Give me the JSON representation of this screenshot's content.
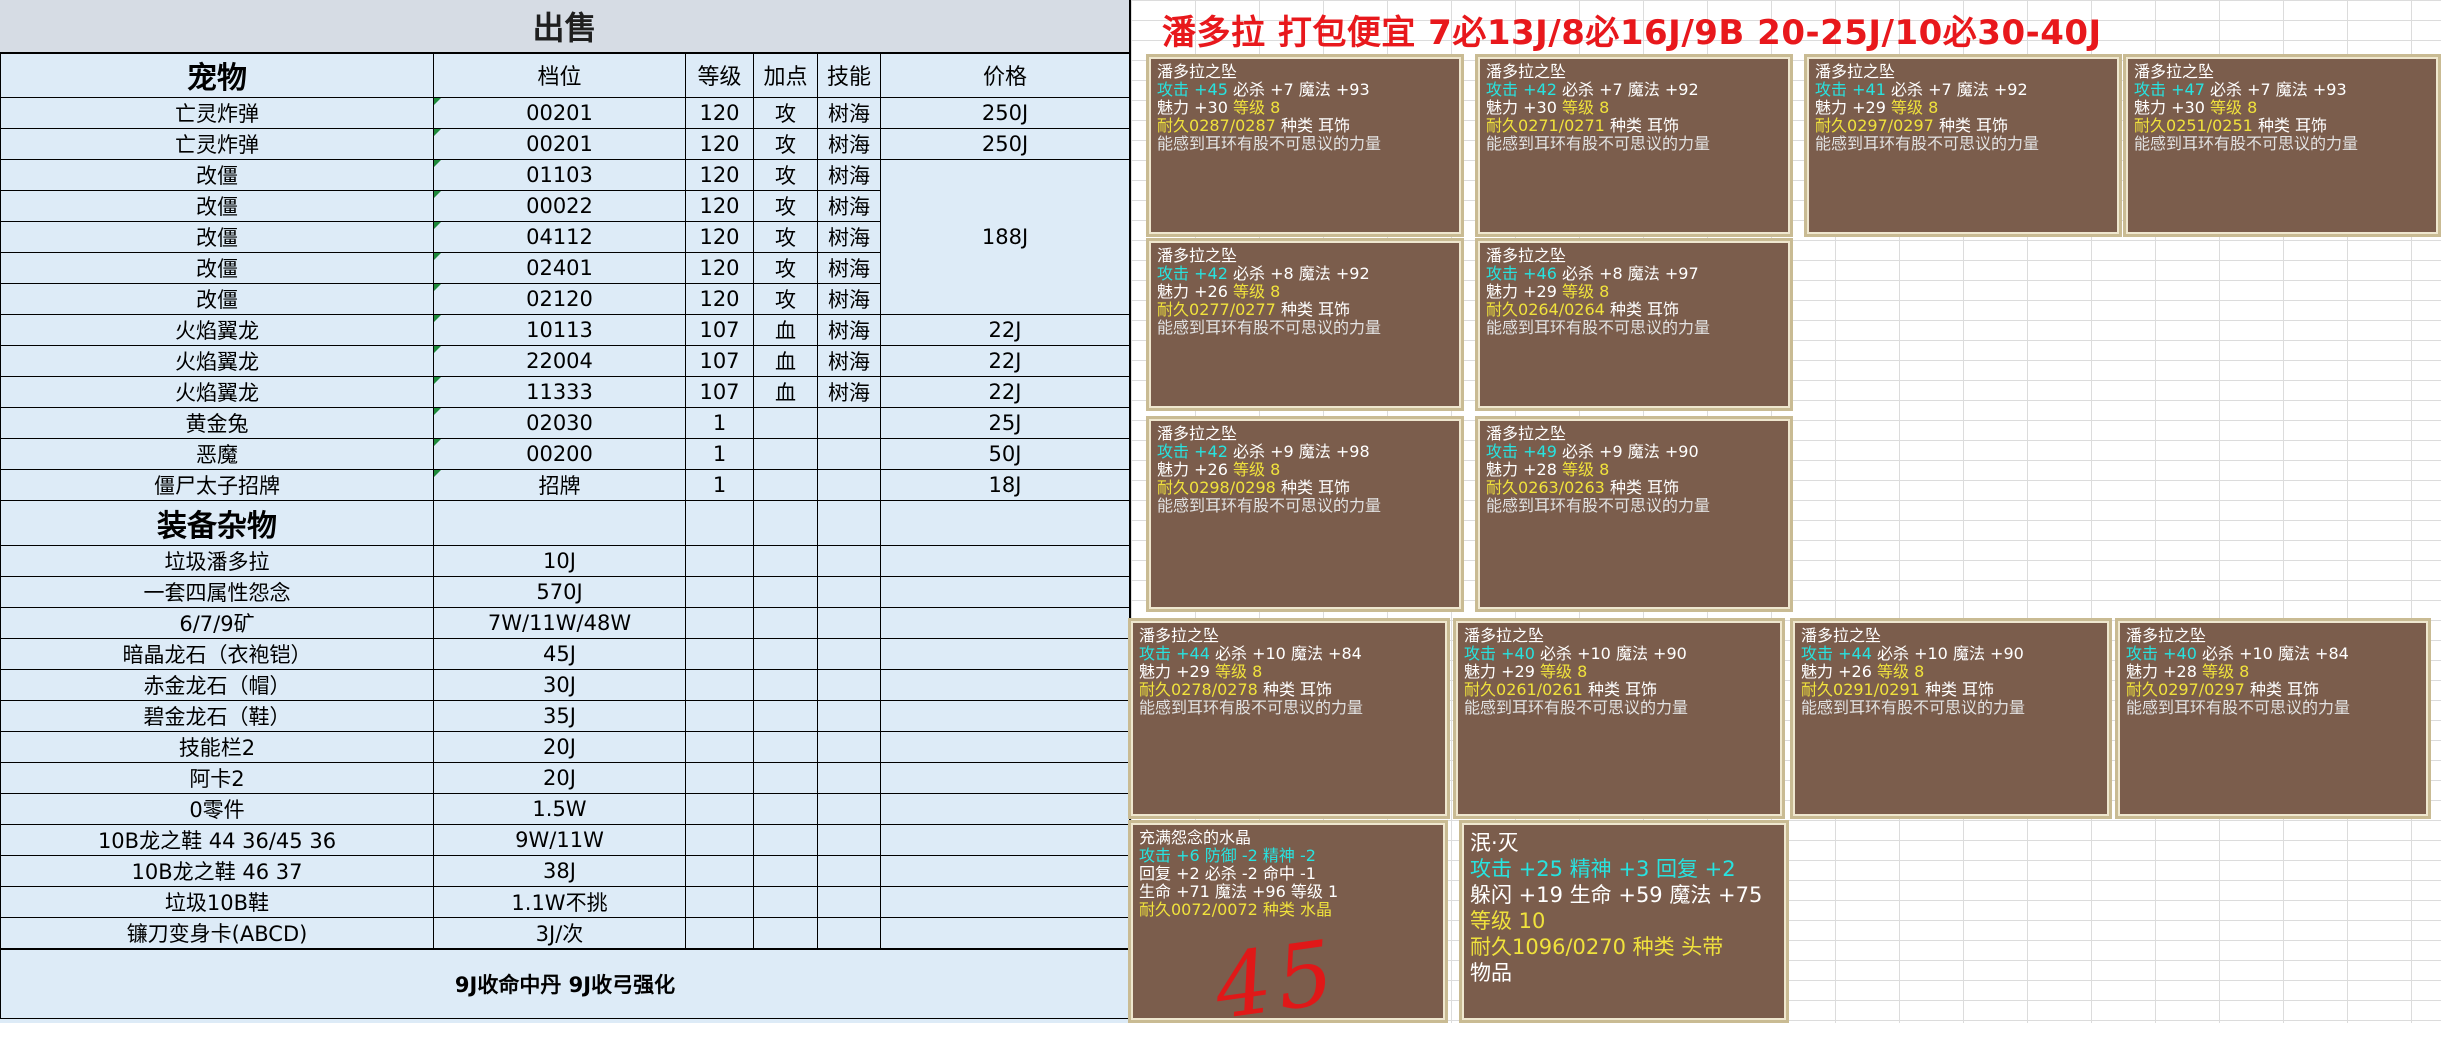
{
  "sheet": {
    "title": "出售",
    "pets_section": "宠物",
    "headers": {
      "slot": "档位",
      "level": "等级",
      "points": "加点",
      "skill": "技能",
      "price": "价格"
    },
    "pets": [
      {
        "name": "亡灵炸弹",
        "slot": "00201",
        "level": "120",
        "points": "攻",
        "skill": "树海",
        "price": "250J"
      },
      {
        "name": "亡灵炸弹",
        "slot": "00201",
        "level": "120",
        "points": "攻",
        "skill": "树海",
        "price": "250J"
      },
      {
        "name": "改僵",
        "slot": "01103",
        "level": "120",
        "points": "攻",
        "skill": "树海"
      },
      {
        "name": "改僵",
        "slot": "00022",
        "level": "120",
        "points": "攻",
        "skill": "树海"
      },
      {
        "name": "改僵",
        "slot": "04112",
        "level": "120",
        "points": "攻",
        "skill": "树海"
      },
      {
        "name": "改僵",
        "slot": "02401",
        "level": "120",
        "points": "攻",
        "skill": "树海"
      },
      {
        "name": "改僵",
        "slot": "02120",
        "level": "120",
        "points": "攻",
        "skill": "树海"
      },
      {
        "name": "火焰翼龙",
        "slot": "10113",
        "level": "107",
        "points": "血",
        "skill": "树海",
        "price": "22J"
      },
      {
        "name": "火焰翼龙",
        "slot": "22004",
        "level": "107",
        "points": "血",
        "skill": "树海",
        "price": "22J"
      },
      {
        "name": "火焰翼龙",
        "slot": "11333",
        "level": "107",
        "points": "血",
        "skill": "树海",
        "price": "22J"
      },
      {
        "name": "黄金兔",
        "slot": "02030",
        "level": "1",
        "points": "",
        "skill": "",
        "price": "25J"
      },
      {
        "name": "恶魔",
        "slot": "00200",
        "level": "1",
        "points": "",
        "skill": "",
        "price": "50J"
      },
      {
        "name": "僵尸太子招牌",
        "slot": "招牌",
        "level": "1",
        "points": "",
        "skill": "",
        "price": "18J"
      }
    ],
    "gaijiang_group_price": "188J",
    "equip_section": "装备杂物",
    "items": [
      {
        "name": "垃圾潘多拉",
        "price": "10J"
      },
      {
        "name": "一套四属性怨念",
        "price": "570J"
      },
      {
        "name": "6/7/9矿",
        "price": "7W/11W/48W"
      },
      {
        "name": "暗晶龙石（衣袍铠）",
        "price": "45J"
      },
      {
        "name": "赤金龙石（帽）",
        "price": "30J"
      },
      {
        "name": "碧金龙石（鞋）",
        "price": "35J"
      },
      {
        "name": "技能栏2",
        "price": "20J"
      },
      {
        "name": "阿卡2",
        "price": "20J"
      },
      {
        "name": "0零件",
        "price": "1.5W"
      },
      {
        "name": "10B龙之鞋 44 36/45 36",
        "price": "9W/11W"
      },
      {
        "name": "10B龙之鞋 46 37",
        "price": "38J"
      },
      {
        "name": "垃圾10B鞋",
        "price": "1.1W不挑"
      },
      {
        "name": "镰刀变身卡(ABCD)",
        "price": "3J/次"
      }
    ],
    "footer": "9J收命中丹 9J收弓强化"
  },
  "banner": "潘多拉 打包便宜 7必13J/8必16J/9B 20-25J/10必30-40J",
  "cards_common": {
    "name": "潘多拉之坠",
    "atk": "攻击",
    "crit": "必杀",
    "magic": "魔法",
    "charm": "魅力",
    "lvl": "等级",
    "dur": "耐久",
    "type": "种类 耳饰",
    "desc": "能感到耳环有股不可思议的力量"
  },
  "cards": [
    {
      "atk": "+45",
      "crit": "+7",
      "magic": "+93",
      "charm": "+30",
      "lvl": "8",
      "dur": "0287/0287"
    },
    {
      "atk": "+42",
      "crit": "+7",
      "magic": "+92",
      "charm": "+30",
      "lvl": "8",
      "dur": "0271/0271"
    },
    {
      "atk": "+41",
      "crit": "+7",
      "magic": "+92",
      "charm": "+29",
      "lvl": "8",
      "dur": "0297/0297"
    },
    {
      "atk": "+47",
      "crit": "+7",
      "magic": "+93",
      "charm": "+30",
      "lvl": "8",
      "dur": "0251/0251"
    },
    {
      "atk": "+42",
      "crit": "+8",
      "magic": "+92",
      "charm": "+26",
      "lvl": "8",
      "dur": "0277/0277"
    },
    {
      "atk": "+46",
      "crit": "+8",
      "magic": "+97",
      "charm": "+29",
      "lvl": "8",
      "dur": "0264/0264"
    },
    {
      "atk": "+42",
      "crit": "+9",
      "magic": "+98",
      "charm": "+26",
      "lvl": "8",
      "dur": "0298/0298"
    },
    {
      "atk": "+49",
      "crit": "+9",
      "magic": "+90",
      "charm": "+28",
      "lvl": "8",
      "dur": "0263/0263"
    },
    {
      "atk": "+44",
      "crit": "+10",
      "magic": "+84",
      "charm": "+29",
      "lvl": "8",
      "dur": "0278/0278"
    },
    {
      "atk": "+40",
      "crit": "+10",
      "magic": "+90",
      "charm": "+29",
      "lvl": "8",
      "dur": "0261/0261"
    },
    {
      "atk": "+44",
      "crit": "+10",
      "magic": "+90",
      "charm": "+26",
      "lvl": "8",
      "dur": "0291/0291"
    },
    {
      "atk": "+40",
      "crit": "+10",
      "magic": "+84",
      "charm": "+28",
      "lvl": "8",
      "dur": "0297/0297"
    }
  ],
  "crystal": {
    "name": "充满怨念的水晶",
    "l1": "攻击 +6 防御 -2 精神 -2",
    "l2": "回复 +2 必杀 -2 命中 -1",
    "l3": "生命 +71 魔法 +96 等级 1",
    "l4": "耐久0072/0072 种类 水晶",
    "handwritten": "45"
  },
  "headband": {
    "name": "泯·灭",
    "l1": "攻击 +25 精神 +3 回复 +2",
    "l2": "躲闪 +19 生命 +59 魔法 +75",
    "l3": "等级 10",
    "l4": "耐久1096/0270 种类 头带",
    "l5": "物品"
  }
}
